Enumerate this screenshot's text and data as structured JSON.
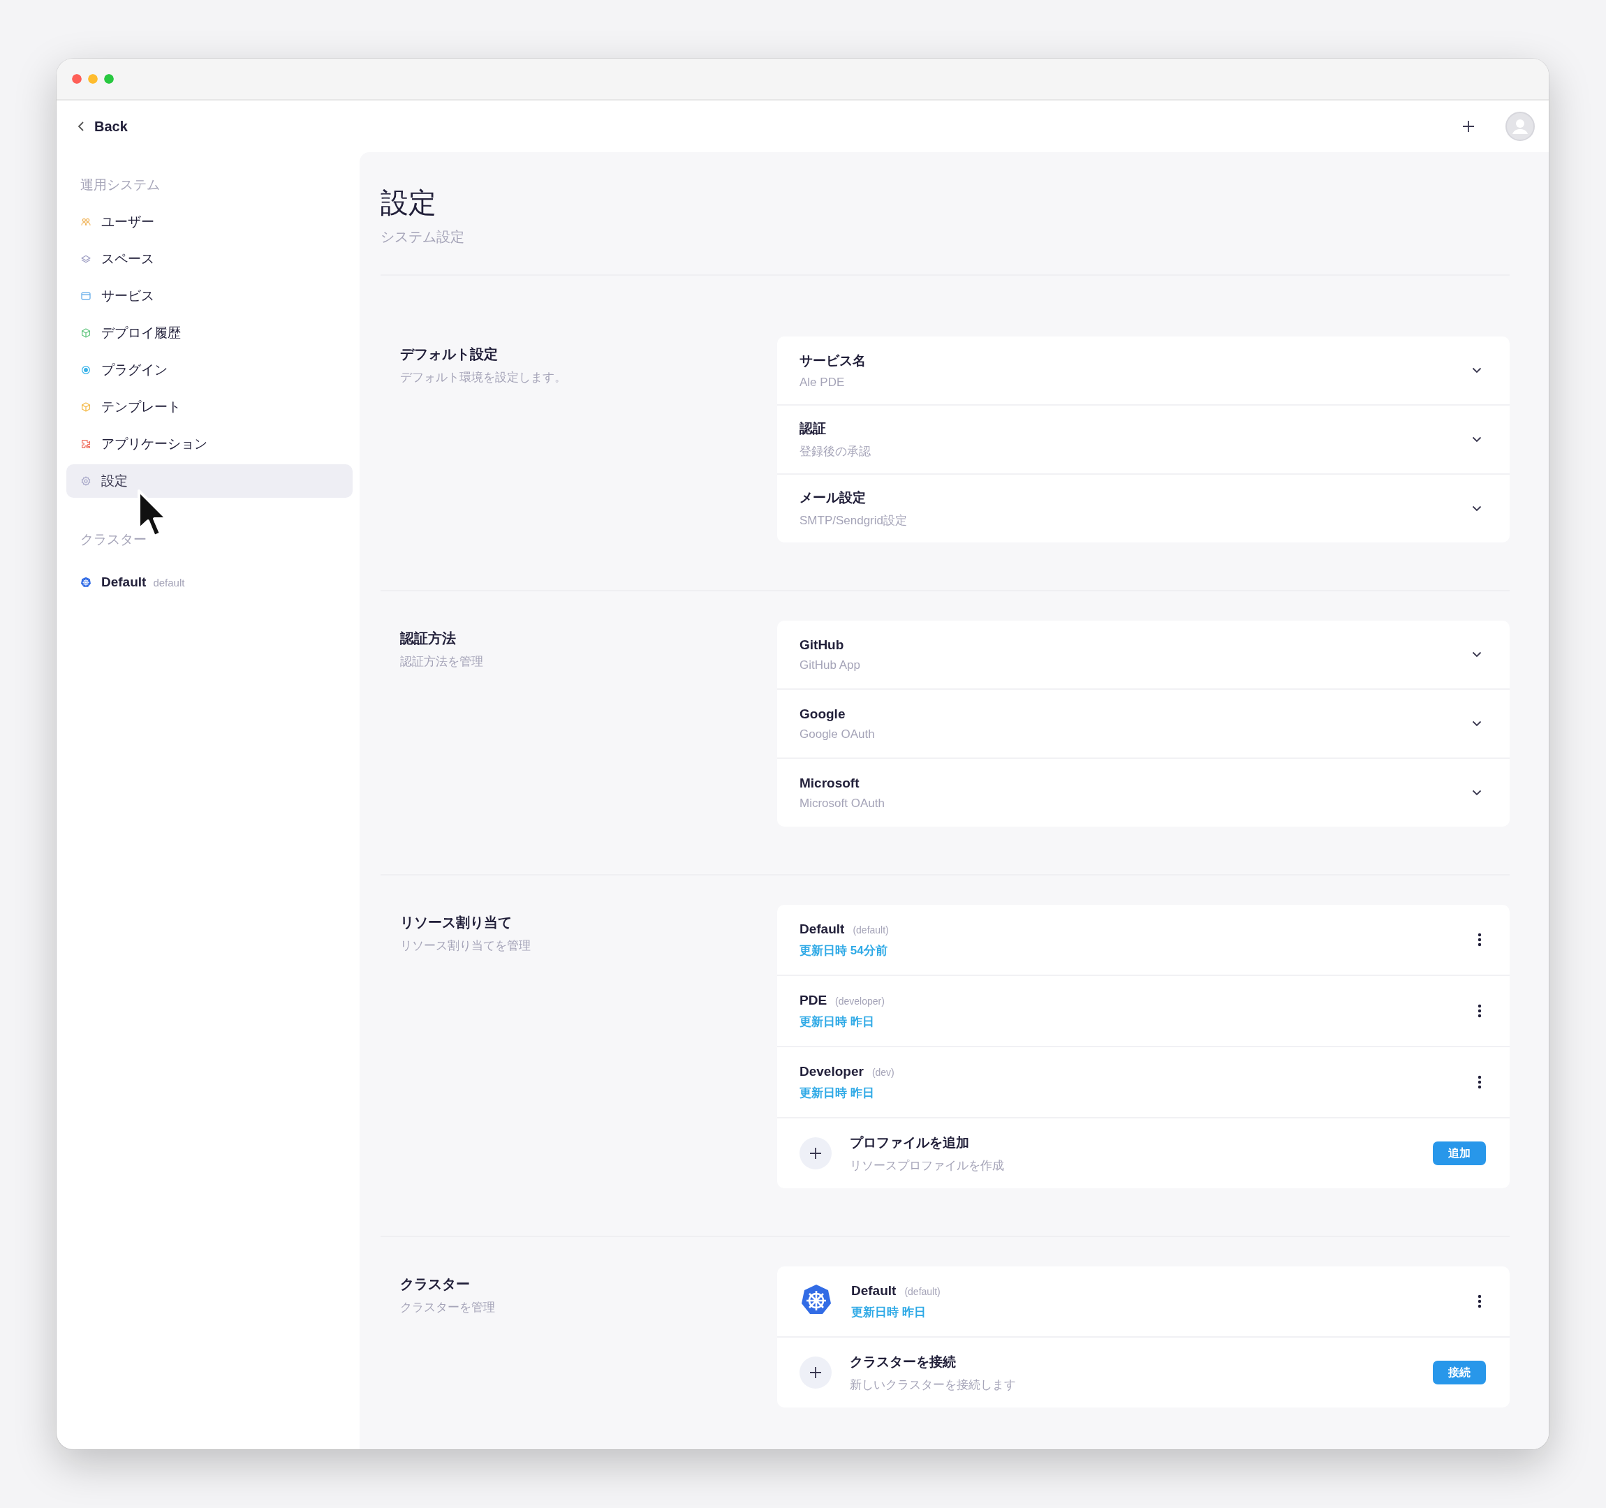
{
  "header": {
    "back": "Back"
  },
  "sidebar": {
    "groups": [
      {
        "kind": "nav",
        "heading": "運用システム",
        "items": [
          {
            "label": "ユーザー",
            "selected": false
          },
          {
            "label": "スペース",
            "selected": false
          },
          {
            "label": "サービス",
            "selected": false
          },
          {
            "label": "デプロイ履歴",
            "selected": false
          },
          {
            "label": "プラグイン",
            "selected": false
          },
          {
            "label": "テンプレート",
            "selected": false
          },
          {
            "label": "アプリケーション",
            "selected": false
          },
          {
            "label": "設定",
            "selected": true
          }
        ]
      },
      {
        "kind": "clusters",
        "heading": "クラスター",
        "items": [
          {
            "label": "Default",
            "tag": "default",
            "selected": false
          }
        ]
      }
    ]
  },
  "page": {
    "title": "設定",
    "subtitle": "システム設定"
  },
  "sections": [
    {
      "title": "デフォルト設定",
      "description": "デフォルト環境を設定します。",
      "rows": [
        {
          "kind": "setting",
          "title": "サービス名",
          "value": "Ale PDE"
        },
        {
          "kind": "setting",
          "title": "認証",
          "value": "登録後の承認"
        },
        {
          "kind": "setting",
          "title": "メール設定",
          "value": "SMTP/Sendgrid設定"
        }
      ]
    },
    {
      "title": "認証方法",
      "description": "認証方法を管理",
      "rows": [
        {
          "kind": "setting",
          "title": "GitHub",
          "value": "GitHub App"
        },
        {
          "kind": "setting",
          "title": "Google",
          "value": "Google OAuth"
        },
        {
          "kind": "setting",
          "title": "Microsoft",
          "value": "Microsoft OAuth"
        }
      ]
    },
    {
      "title": "リソース割り当て",
      "description": "リソース割り当てを管理",
      "rows": [
        {
          "kind": "profile",
          "name": "Default",
          "tag": "(default)",
          "updated": "更新日時 54分前"
        },
        {
          "kind": "profile",
          "name": "PDE",
          "tag": "(developer)",
          "updated": "更新日時 昨日"
        },
        {
          "kind": "profile",
          "name": "Developer",
          "tag": "(dev)",
          "updated": "更新日時 昨日"
        },
        {
          "kind": "add",
          "title": "プロファイルを追加",
          "description": "リソースプロファイルを作成",
          "button": "追加"
        }
      ]
    },
    {
      "title": "クラスター",
      "description": "クラスターを管理",
      "rows": [
        {
          "kind": "cluster",
          "name": "Default",
          "tag": "(default)",
          "updated": "更新日時 昨日"
        },
        {
          "kind": "add",
          "title": "クラスターを接続",
          "description": "新しいクラスターを接続します",
          "button": "接続"
        }
      ]
    }
  ]
}
